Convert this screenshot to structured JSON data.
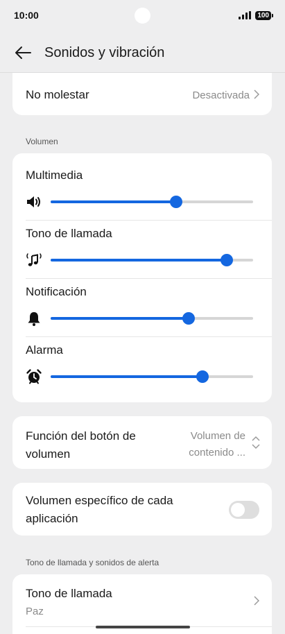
{
  "status_bar": {
    "time": "10:00",
    "battery": "100"
  },
  "app_bar": {
    "title": "Sonidos y vibración"
  },
  "do_not_disturb": {
    "label": "No molestar",
    "value": "Desactivada"
  },
  "volume_section": {
    "label": "Volumen",
    "sliders": [
      {
        "label": "Multimedia",
        "icon": "speaker-icon",
        "level": 0.62
      },
      {
        "label": "Tono de llamada",
        "icon": "music-note-icon",
        "level": 0.87
      },
      {
        "label": "Notificación",
        "icon": "bell-icon",
        "level": 0.68
      },
      {
        "label": "Alarma",
        "icon": "alarm-clock-icon",
        "level": 0.75
      }
    ]
  },
  "volume_button": {
    "label_line1": "Función del botón de",
    "label_line2": "volumen",
    "value_line1": "Volumen de",
    "value_line2": "contenido ..."
  },
  "per_app_volume": {
    "label_line1": "Volumen específico de cada",
    "label_line2": "aplicación",
    "enabled": false
  },
  "ringtone_section": {
    "label": "Tono de llamada y sonidos de alerta"
  },
  "ringtone": {
    "label": "Tono de llamada",
    "value": "Paz"
  },
  "colors": {
    "accent": "#1467e0",
    "background": "#eeeeef",
    "card": "#ffffff"
  }
}
